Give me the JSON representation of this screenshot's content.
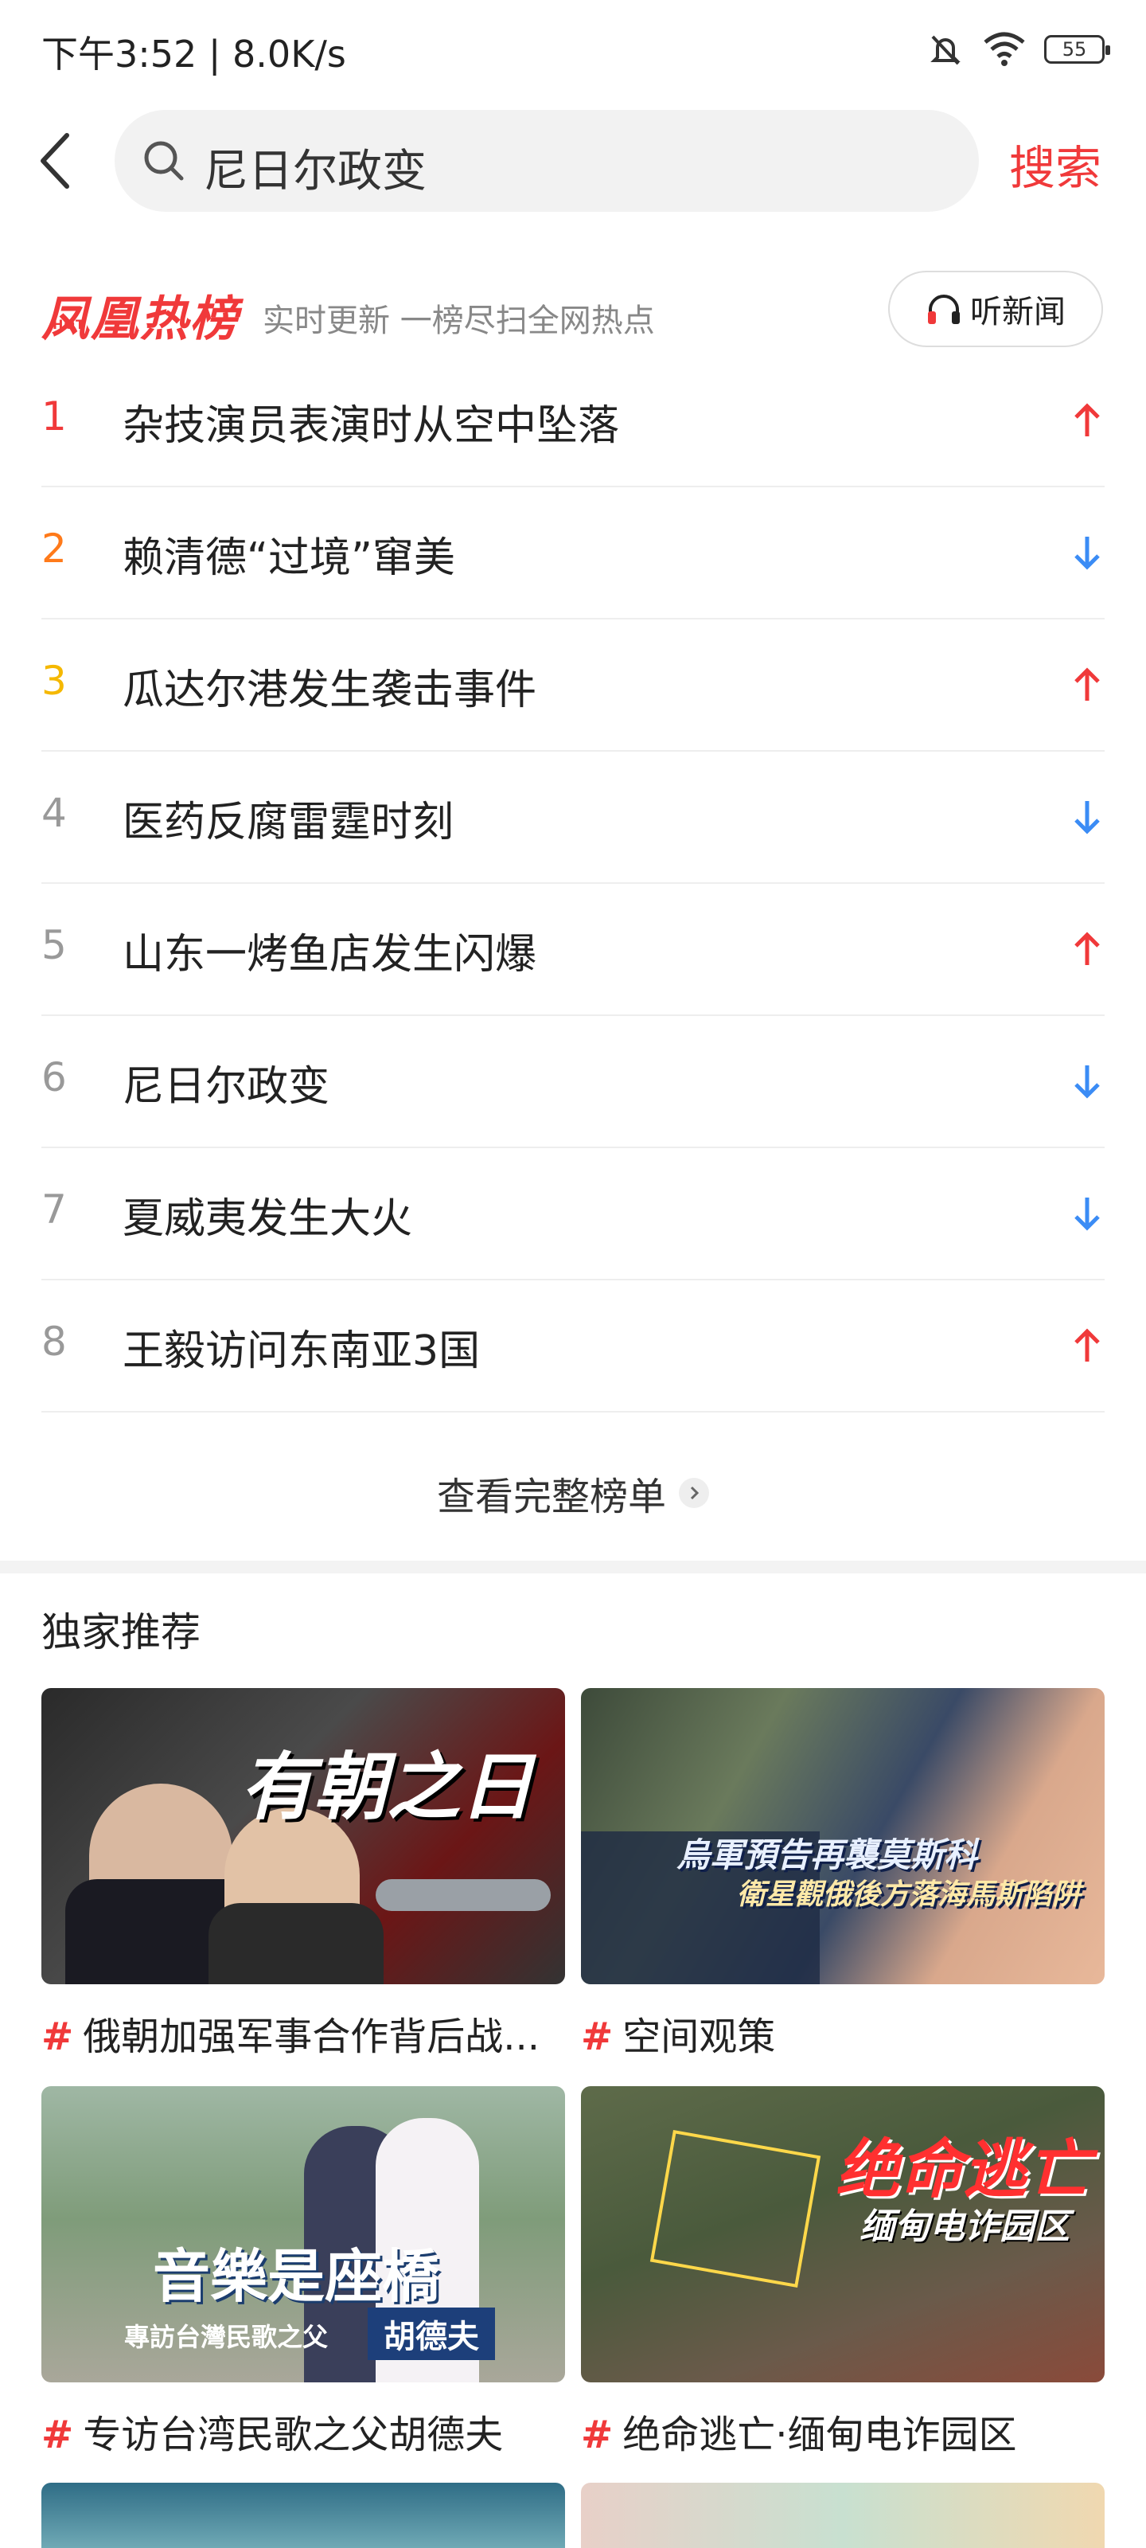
{
  "status": {
    "time": "下午3:52 | 8.0K/s",
    "battery": "55"
  },
  "search": {
    "query": "尼日尔政变",
    "button": "搜索"
  },
  "hot": {
    "logo": "凤凰热榜",
    "logo_tag": "HOT",
    "subtitle": "实时更新 一榜尽扫全网热点",
    "listen_label": "听新闻",
    "items": [
      {
        "rank": "1",
        "title": "杂技演员表演时从空中坠落",
        "trend": "up"
      },
      {
        "rank": "2",
        "title": "赖清德“过境”窜美",
        "trend": "down"
      },
      {
        "rank": "3",
        "title": "瓜达尔港发生袭击事件",
        "trend": "up"
      },
      {
        "rank": "4",
        "title": "医药反腐雷霆时刻",
        "trend": "down"
      },
      {
        "rank": "5",
        "title": "山东一烤鱼店发生闪爆",
        "trend": "up"
      },
      {
        "rank": "6",
        "title": "尼日尔政变",
        "trend": "down"
      },
      {
        "rank": "7",
        "title": "夏威夷发生大火",
        "trend": "down"
      },
      {
        "rank": "8",
        "title": "王毅访问东南亚3国",
        "trend": "up"
      }
    ],
    "more_label": "查看完整榜单"
  },
  "exclusive": {
    "title": "独家推荐",
    "cards": [
      {
        "caption": "俄朝加强军事合作背后战...",
        "overlay": "有朝之日"
      },
      {
        "caption": "空间观策",
        "overlay": "烏軍預告再襲莫斯科",
        "overlay2": "衛星觀俄後方落海馬斯陷阱"
      },
      {
        "caption": "专访台湾民歌之父胡德夫",
        "overlay": "音樂是座橋",
        "overlay2": "專訪台灣民歌之父",
        "overlay3": "胡德夫"
      },
      {
        "caption": "绝命逃亡·缅甸电诈园区",
        "overlay": "绝命逃亡",
        "overlay2": "缅甸电诈园区"
      }
    ]
  },
  "colors": {
    "accent": "#f0393a",
    "rank1": "#f0393a",
    "rank2": "#ff7a1a",
    "rank3": "#f5b800",
    "rank_other": "#999999",
    "down": "#3b8cf5"
  }
}
